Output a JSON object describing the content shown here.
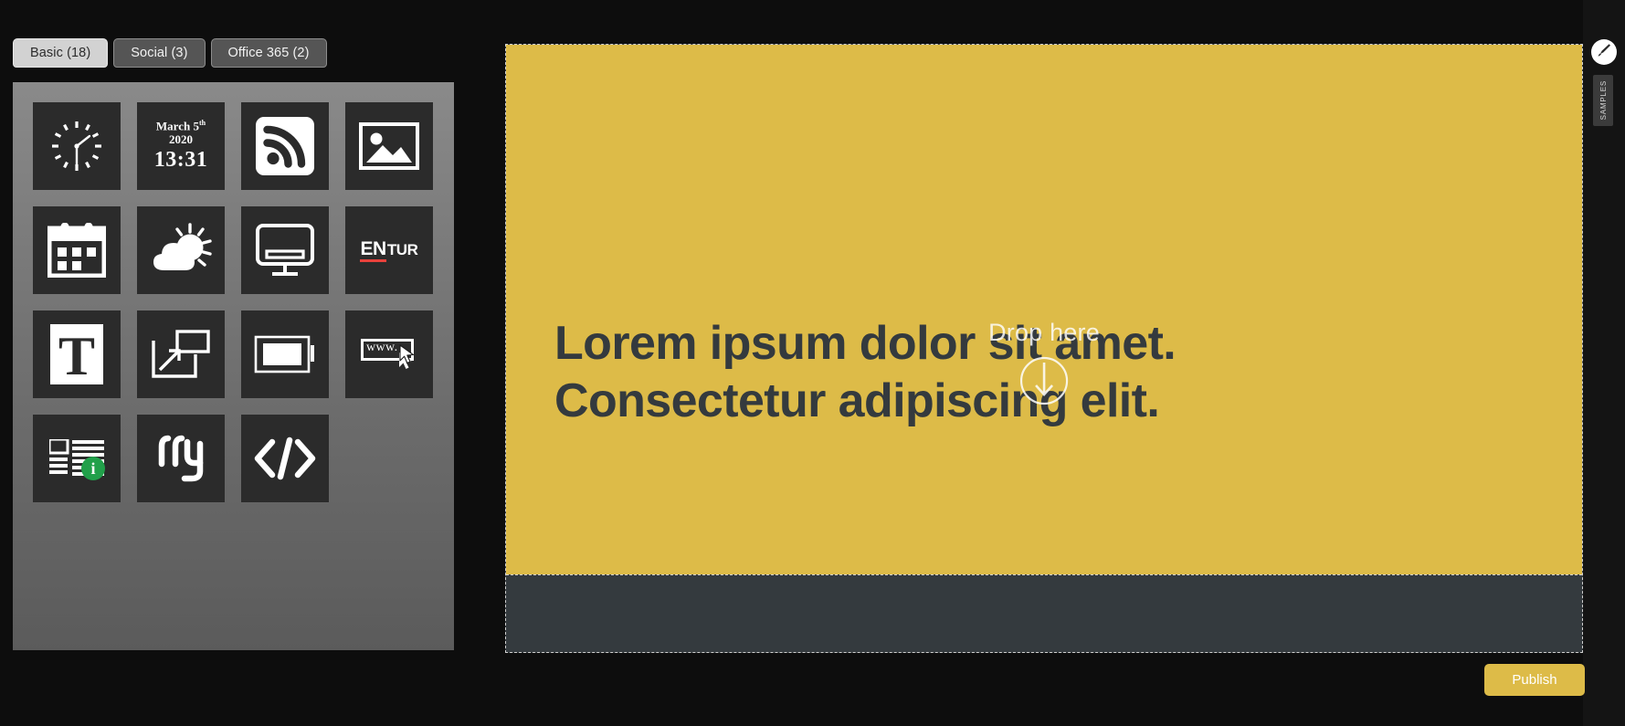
{
  "panel": {
    "tabs": [
      {
        "label": "Basic (18)",
        "active": true
      },
      {
        "label": "Social (3)",
        "active": false
      },
      {
        "label": "Office 365 (2)",
        "active": false
      }
    ],
    "widgets": [
      {
        "name": "clock-widget",
        "icon": "clock-icon"
      },
      {
        "name": "datetime-widget",
        "icon": "date-time-icon",
        "date": "March 5",
        "date_sup": "th",
        "year": "2020",
        "time": "13:31"
      },
      {
        "name": "rss-widget",
        "icon": "rss-feed-icon"
      },
      {
        "name": "image-widget",
        "icon": "picture-icon"
      },
      {
        "name": "calendar-widget",
        "icon": "calendar-icon"
      },
      {
        "name": "weather-widget",
        "icon": "cloud-sun-icon"
      },
      {
        "name": "display-widget",
        "icon": "monitor-icon"
      },
      {
        "name": "entur-widget",
        "icon": "entur-logo-icon",
        "logo_a": "EN",
        "logo_b": "TUR"
      },
      {
        "name": "text-widget",
        "icon": "text-t-icon"
      },
      {
        "name": "transition-widget",
        "icon": "resize-window-icon"
      },
      {
        "name": "video-widget",
        "icon": "media-frame-icon"
      },
      {
        "name": "web-widget",
        "icon": "www-browser-icon",
        "label": "www."
      },
      {
        "name": "news-widget",
        "icon": "news-info-icon",
        "badge": "i"
      },
      {
        "name": "flyt-widget",
        "icon": "flyt-logo-icon"
      },
      {
        "name": "embed-widget",
        "icon": "html-code-icon"
      }
    ]
  },
  "canvas": {
    "headline_line1": "Lorem ipsum dolor sit amet.",
    "headline_line2": "Consectetur adipiscing elit.",
    "drop_label": "Drop here",
    "drop_icon": "drop-down-arrow-circle-icon",
    "dragged_widget_icon": "clock-icon"
  },
  "rail": {
    "brush_icon": "paint-brush-icon",
    "samples_label": "SAMPLES"
  },
  "actions": {
    "publish_label": "Publish"
  },
  "cursor": {
    "icon": "mouse-pointer-icon"
  },
  "colors": {
    "accent_gold": "#ddbb48",
    "dark_slate": "#343a3e",
    "panel_bg_top": "#8a8a8a",
    "panel_bg_bottom": "#5b5b5b",
    "tile_bg": "#2b2b2b",
    "badge_green": "#21a04a",
    "entur_red": "#e8413c",
    "app_bg": "#0d0d0d"
  }
}
